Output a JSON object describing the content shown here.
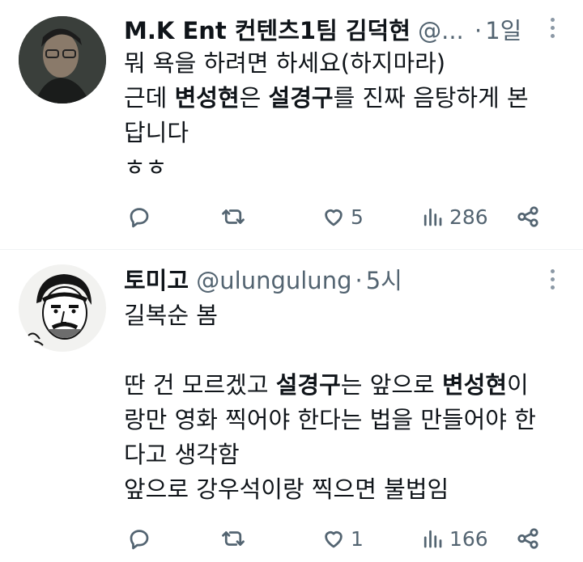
{
  "tweets": [
    {
      "name": "M.K Ent 컨텐츠1팀 김덕현",
      "handle": "@...",
      "time": "1일",
      "lines": [
        [
          {
            "t": "뭐 욕을 하려면 하세요(하지마라)",
            "b": false
          }
        ],
        [
          {
            "t": "근데 ",
            "b": false
          },
          {
            "t": "변성현",
            "b": true
          },
          {
            "t": "은 ",
            "b": false
          },
          {
            "t": "설경구",
            "b": true
          },
          {
            "t": "를 진짜 음탕하게 본",
            "b": false
          }
        ],
        [
          {
            "t": "답니다",
            "b": false
          }
        ],
        [
          {
            "t": "ㅎㅎ",
            "b": false
          }
        ]
      ],
      "stats": {
        "replies": "",
        "retweets": "",
        "likes": "5",
        "views": "286"
      }
    },
    {
      "name": "토미고",
      "handle": "@ulungulung",
      "time": "5시",
      "lines": [
        [
          {
            "t": "길복순 봄",
            "b": false
          }
        ],
        [
          {
            "t": "",
            "b": false
          }
        ],
        [
          {
            "t": "딴 건 모르겠고 ",
            "b": false
          },
          {
            "t": "설경구",
            "b": true
          },
          {
            "t": "는 앞으로 ",
            "b": false
          },
          {
            "t": "변성현",
            "b": true
          },
          {
            "t": "이",
            "b": false
          }
        ],
        [
          {
            "t": "랑만 영화 찍어야 한다는 법을 만들어야 한",
            "b": false
          }
        ],
        [
          {
            "t": "다고 생각함",
            "b": false
          }
        ],
        [
          {
            "t": "앞으로 강우석이랑 찍으면 불법임",
            "b": false
          }
        ]
      ],
      "stats": {
        "replies": "",
        "retweets": "",
        "likes": "1",
        "views": "166"
      }
    }
  ]
}
